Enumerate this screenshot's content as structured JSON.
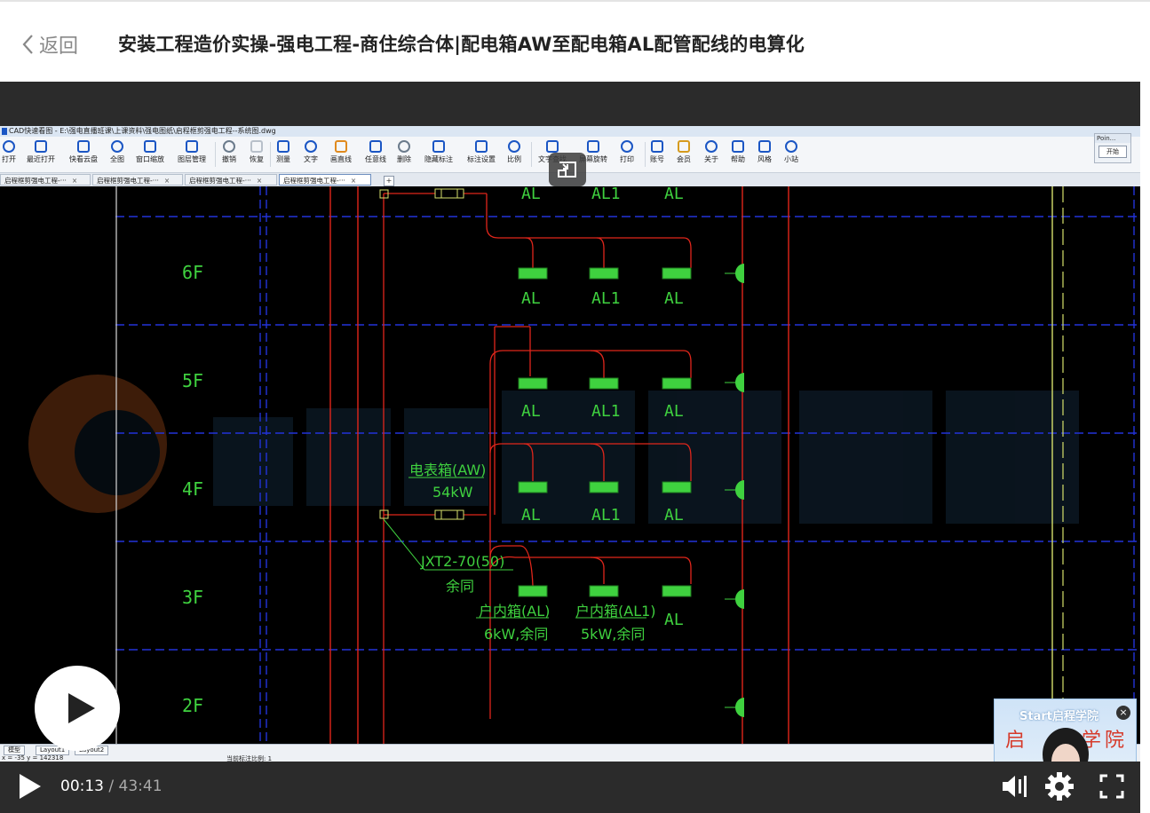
{
  "header": {
    "back_label": "返回",
    "title": "安装工程造价实操-强电工程-商住综合体|配电箱AW至配电箱AL配管配线的电算化"
  },
  "cad": {
    "window_title": "CAD快速看图 - E:\\强电直播班课\\上课资料\\强电图纸\\启程框剪强电工程--系统图.dwg",
    "toolbar": [
      "打开",
      "最近打开",
      "快看云盘",
      "全图",
      "窗口缩放",
      "图层管理",
      "撤销",
      "恢复",
      "测量",
      "文字",
      "画直线",
      "任意线",
      "删除",
      "隐藏标注",
      "标注设置",
      "比例",
      "文字查找",
      "屏幕旋转",
      "打印",
      "账号",
      "会员",
      "关于",
      "帮助",
      "风格",
      "小站"
    ],
    "poin_label": "Poin...",
    "start_label": "开始",
    "tabs": [
      "启程框剪强电工程-···",
      "启程框剪强电工程-···",
      "启程框剪强电工程-···",
      "启程框剪强电工程-···"
    ],
    "layout_tabs": [
      "模型",
      "Layout1",
      "Layout2"
    ],
    "coords": "x = -35 y = 142318",
    "scale_text": "当前标注比例: 1"
  },
  "drawing": {
    "floors": [
      "6F",
      "5F",
      "4F",
      "3F",
      "2F"
    ],
    "box_labels_row": [
      "AL",
      "AL1",
      "AL"
    ],
    "meter_box": "电表箱(AW)",
    "meter_power": "54kW",
    "cable": "JXT2-70(50)",
    "cable_note": "余同",
    "indoor_al": "户内箱(AL)",
    "indoor_al_power": "6kW,余同",
    "indoor_al1": "户内箱(AL1)",
    "indoor_al1_power": "5kW,余同",
    "watermark": "Start启程学院"
  },
  "pip": {
    "brand": "Start启程学院",
    "cn1": "启",
    "cn2": "学",
    "cn3": "院"
  },
  "controls": {
    "current_time": "00:13",
    "separator": " / ",
    "total_time": "43:41"
  },
  "colors": {
    "green": "#3fd13f",
    "red": "#e0261b",
    "blue": "#2233d9",
    "yellow_green": "#d6e06b"
  }
}
